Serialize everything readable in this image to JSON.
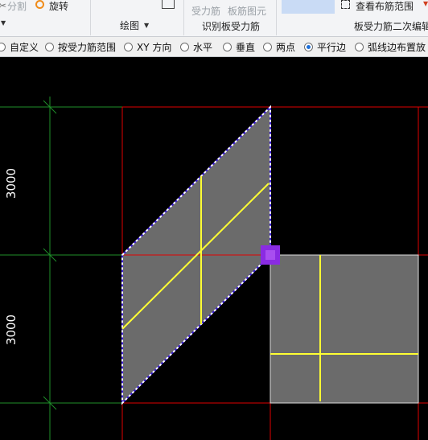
{
  "ribbon": {
    "split_label": "分割",
    "rotate_label": "旋转",
    "draw_group": "绘图",
    "force_rebar_label": "受力筋",
    "slab_element_label": "板筋图元",
    "identify_group": "识别板受力筋",
    "view_range_label": "查看布筋范围",
    "edit_group": "板受力筋二次编辑"
  },
  "options": [
    {
      "label": "自定义",
      "selected": false
    },
    {
      "label": "按受力筋范围",
      "selected": false
    },
    {
      "label": "XY 方向",
      "selected": false
    },
    {
      "label": "水平",
      "selected": false
    },
    {
      "label": "垂直",
      "selected": false
    },
    {
      "label": "两点",
      "selected": false
    },
    {
      "label": "平行边",
      "selected": true
    },
    {
      "label": "弧线边布置放",
      "selected": false
    }
  ],
  "canvas": {
    "dim_upper": "3000",
    "dim_lower": "3000",
    "colors": {
      "background": "#000000",
      "axis": "#e00000",
      "dimension": "#1f8f2a",
      "slab": "#6b6b6b",
      "rebar": "#ffff33",
      "selection": "#8a2be2"
    }
  }
}
